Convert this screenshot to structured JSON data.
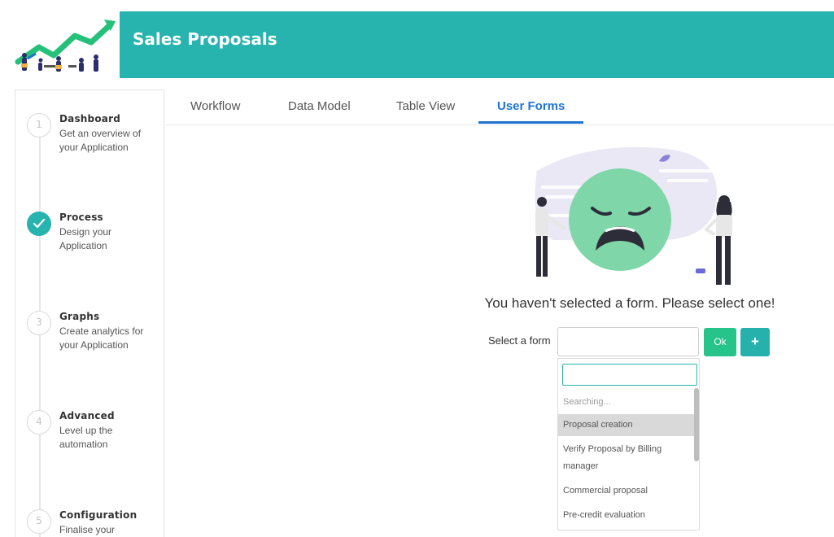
{
  "header": {
    "title": "Sales Proposals"
  },
  "sidebar": {
    "steps": [
      {
        "number": "1",
        "title": "Dashboard",
        "desc": "Get an overview of your Application",
        "state": "pending"
      },
      {
        "number": "",
        "title": "Process",
        "desc": "Design your Application",
        "state": "completed"
      },
      {
        "number": "3",
        "title": "Graphs",
        "desc": "Create analytics for your Application",
        "state": "pending"
      },
      {
        "number": "4",
        "title": "Advanced",
        "desc": "Level up the automation",
        "state": "pending"
      },
      {
        "number": "5",
        "title": "Configuration",
        "desc": "Finalise your",
        "state": "pending"
      }
    ]
  },
  "tabs": [
    {
      "label": "Workflow",
      "active": false
    },
    {
      "label": "Data Model",
      "active": false
    },
    {
      "label": "Table View",
      "active": false
    },
    {
      "label": "User Forms",
      "active": true
    }
  ],
  "main": {
    "empty_message": "You haven't selected a form. Please select one!",
    "select_label": "Select a form",
    "ok_label": "Ok",
    "add_label": "+",
    "dropdown": {
      "search_value": "",
      "status": "Searching...",
      "options": [
        {
          "label": "Proposal creation",
          "highlighted": true
        },
        {
          "label": "Verify Proposal by Billing manager",
          "highlighted": false
        },
        {
          "label": "Commercial proposal",
          "highlighted": false
        },
        {
          "label": "Pre-credit evaluation",
          "highlighted": false
        }
      ]
    }
  },
  "colors": {
    "brand_teal": "#27b3ae",
    "active_tab_blue": "#1e73d2",
    "ok_green": "#26c38b",
    "face_green": "#7fd6a8"
  },
  "icons": {
    "logo": "sales-growth-illustration",
    "completed_step": "check-icon",
    "empty_state": "sad-face-illustration"
  }
}
